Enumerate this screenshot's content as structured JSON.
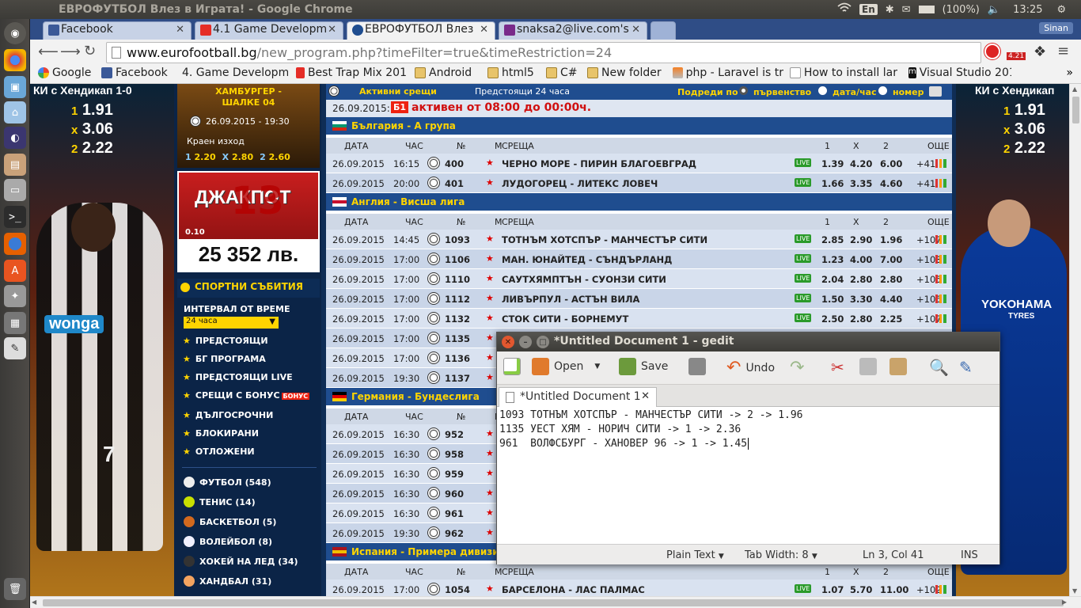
{
  "topbar": {
    "window_title": "ЕВРОФУТБОЛ Влез в Играта! - Google Chrome",
    "keyboard": "En",
    "battery": "(100%)",
    "time": "13:25"
  },
  "browser": {
    "tabs": [
      {
        "label": "Facebook",
        "color": "#3b5998"
      },
      {
        "label": "4.1 Game Developm",
        "color": "#e52d27"
      },
      {
        "label": "ЕВРОФУТБОЛ Влез",
        "color": "#1f4d8f"
      },
      {
        "label": "snaksa2@live.com's",
        "color": "#7a2a8a"
      }
    ],
    "profile": "Sinan",
    "url_host": "www.eurofootball.bg",
    "url_path": "/new_program.php?timeFilter=true&timeRestriction=24",
    "ext_badge": "4.21",
    "bookmarks": [
      {
        "label": "Google",
        "icon": "google-icon"
      },
      {
        "label": "Facebook",
        "icon": "facebook-icon"
      },
      {
        "label": "4. Game Developm",
        "icon": "youtube-icon"
      },
      {
        "label": "Best Trap Mix 201",
        "icon": "youtube-icon"
      },
      {
        "label": "Android",
        "icon": "folder-icon"
      },
      {
        "label": "html5",
        "icon": "folder-icon"
      },
      {
        "label": "C#",
        "icon": "folder-icon"
      },
      {
        "label": "New folder",
        "icon": "folder-icon"
      },
      {
        "label": "php - Laravel is tr",
        "icon": "stackoverflow-icon"
      },
      {
        "label": "How to install lar",
        "icon": "page-icon"
      },
      {
        "label": "Visual Studio 201",
        "icon": "m-icon"
      }
    ]
  },
  "ads": {
    "left_title": "КИ с Хендикап 1-0",
    "right_title": "КИ с Хендикап",
    "odds": [
      {
        "label": "1",
        "value": "1.91"
      },
      {
        "label": "x",
        "value": "3.06"
      },
      {
        "label": "2",
        "value": "2.22"
      }
    ],
    "shirt_sponsor_left": "wonga",
    "shirt_sponsor_right": "YOKOHAMA",
    "shirt_sponsor_right_sub": "TYRES",
    "shirt_number": "7"
  },
  "sidebar": {
    "featured_match": "ХАМБУРГЕР - ШАЛКЕ 04",
    "featured_date": "26.09.2015 - 19:30",
    "final_label": "Краен изход",
    "final_odds": [
      {
        "label": "1",
        "value": "2.20"
      },
      {
        "label": "X",
        "value": "2.80"
      },
      {
        "label": "2",
        "value": "2.60"
      }
    ],
    "jackpot_title": "ДЖАКПОТ",
    "jackpot_number": "13",
    "jackpot_small": "0.10",
    "jackpot_amount": "25 352 лв.",
    "events_title": "СПОРТНИ СЪБИТИЯ",
    "interval_label": "ИНТЕРВАЛ ОТ ВРЕМЕ",
    "interval_value": "24 часа",
    "menu": [
      "ПРЕДСТОЯЩИ",
      "БГ ПРОГРАМА",
      "ПРЕДСТОЯЩИ LIVE",
      "СРЕЩИ С БОНУС",
      "ДЪЛГОСРОЧНИ",
      "БЛОКИРАНИ",
      "ОТЛОЖЕНИ"
    ],
    "bonus_badge": "БОНУС",
    "sports": [
      {
        "label": "ФУТБОЛ (548)",
        "color": "#eeeeee"
      },
      {
        "label": "ТЕНИС (14)",
        "color": "#c8e000"
      },
      {
        "label": "БАСКЕТБОЛ (5)",
        "color": "#d2691e"
      },
      {
        "label": "ВОЛЕЙБОЛ (8)",
        "color": "#f0f0ff"
      },
      {
        "label": "ХОКЕЙ НА ЛЕД (34)",
        "color": "#333333"
      },
      {
        "label": "ХАНДБАЛ (31)",
        "color": "#f4a460"
      }
    ]
  },
  "main": {
    "active_label": "Активни срещи",
    "shown_label": "Предстоящи 24 часа",
    "sort_label": "Подреди по",
    "sort_options": [
      "първенство",
      "дата/час",
      "номер"
    ],
    "date_label": "26.09.2015:",
    "b1_badge": "Б1",
    "active_time": "активен от 08:00 до 00:00ч.",
    "columns": [
      "ДАТА",
      "ЧАС",
      "№",
      "М",
      "СРЕЩА",
      "1",
      "X",
      "2",
      "ОЩЕ"
    ],
    "live_badge": "LIVE",
    "leagues": [
      {
        "name": "България - А група",
        "rows": [
          {
            "date": "26.09.2015",
            "time": "16:15",
            "num": "400",
            "match": "ЧЕРНО МОРЕ - ПИРИН БЛАГОЕВГРАД",
            "o1": "1.39",
            "ox": "4.20",
            "o2": "6.00",
            "more": "+41"
          },
          {
            "date": "26.09.2015",
            "time": "20:00",
            "num": "401",
            "match": "ЛУДОГОРЕЦ - ЛИТЕКС ЛОВЕЧ",
            "o1": "1.66",
            "ox": "3.35",
            "o2": "4.60",
            "more": "+41"
          }
        ]
      },
      {
        "name": "Англия - Висша лига",
        "rows": [
          {
            "date": "26.09.2015",
            "time": "14:45",
            "num": "1093",
            "match": "ТОТНЪМ ХОТСПЪР - МАНЧЕСТЪР СИТИ",
            "o1": "2.85",
            "ox": "2.90",
            "o2": "1.96",
            "more": "+107"
          },
          {
            "date": "26.09.2015",
            "time": "17:00",
            "num": "1106",
            "match": "МАН. ЮНАЙТЕД - СЪНДЪРЛАНД",
            "o1": "1.23",
            "ox": "4.00",
            "o2": "7.00",
            "more": "+103"
          },
          {
            "date": "26.09.2015",
            "time": "17:00",
            "num": "1110",
            "match": "САУТХЯМПТЪН - СУОНЗИ СИТИ",
            "o1": "2.04",
            "ox": "2.80",
            "o2": "2.80",
            "more": "+105"
          },
          {
            "date": "26.09.2015",
            "time": "17:00",
            "num": "1112",
            "match": "ЛИВЪРПУЛ - АСТЪН ВИЛА",
            "o1": "1.50",
            "ox": "3.30",
            "o2": "4.40",
            "more": "+106"
          },
          {
            "date": "26.09.2015",
            "time": "17:00",
            "num": "1132",
            "match": "СТОК СИТИ - БОРНЕМУТ",
            "o1": "2.50",
            "ox": "2.80",
            "o2": "2.25",
            "more": "+107"
          },
          {
            "date": "26.09.2015",
            "time": "17:00",
            "num": "1135",
            "match": "",
            "o1": "",
            "ox": "",
            "o2": "",
            "more": ""
          },
          {
            "date": "26.09.2015",
            "time": "17:00",
            "num": "1136",
            "match": "",
            "o1": "",
            "ox": "",
            "o2": "",
            "more": ""
          },
          {
            "date": "26.09.2015",
            "time": "19:30",
            "num": "1137",
            "match": "",
            "o1": "",
            "ox": "",
            "o2": "",
            "more": ""
          }
        ]
      },
      {
        "name": "Германия - Бундеслига",
        "rows": [
          {
            "date": "26.09.2015",
            "time": "16:30",
            "num": "952",
            "match": "",
            "o1": "",
            "ox": "",
            "o2": "",
            "more": ""
          },
          {
            "date": "26.09.2015",
            "time": "16:30",
            "num": "958",
            "match": "",
            "o1": "",
            "ox": "",
            "o2": "",
            "more": ""
          },
          {
            "date": "26.09.2015",
            "time": "16:30",
            "num": "959",
            "match": "",
            "o1": "",
            "ox": "",
            "o2": "",
            "more": ""
          },
          {
            "date": "26.09.2015",
            "time": "16:30",
            "num": "960",
            "match": "",
            "o1": "",
            "ox": "",
            "o2": "",
            "more": ""
          },
          {
            "date": "26.09.2015",
            "time": "16:30",
            "num": "961",
            "match": "",
            "o1": "",
            "ox": "",
            "o2": "",
            "more": ""
          },
          {
            "date": "26.09.2015",
            "time": "19:30",
            "num": "962",
            "match": "",
            "o1": "",
            "ox": "",
            "o2": "",
            "more": ""
          }
        ]
      },
      {
        "name": "Испания - Примера дивизио",
        "rows": [
          {
            "date": "26.09.2015",
            "time": "17:00",
            "num": "1054",
            "match": "БАРСЕЛОНА - ЛАС ПАЛМАС",
            "o1": "1.07",
            "ox": "5.70",
            "o2": "11.00",
            "more": "+102"
          }
        ]
      }
    ]
  },
  "gedit": {
    "title": "*Untitled Document 1 - gedit",
    "toolbar": {
      "open": "Open",
      "save": "Save",
      "undo": "Undo"
    },
    "tab_label": "*Untitled Document 1",
    "lines": [
      "1093 ТОТНЪМ ХОТСПЪР - МАНЧЕСТЪР СИТИ -> 2 -> 1.96",
      "1135 УЕСТ ХЯМ - НОРИЧ СИТИ -> 1 -> 2.36",
      "961  ВОЛФСБУРГ - ХАНОВЕР 96 -> 1 -> 1.45"
    ],
    "status": {
      "lang": "Plain Text",
      "tab_width": "Tab Width: 8",
      "position": "Ln 3, Col 41",
      "mode": "INS"
    }
  }
}
